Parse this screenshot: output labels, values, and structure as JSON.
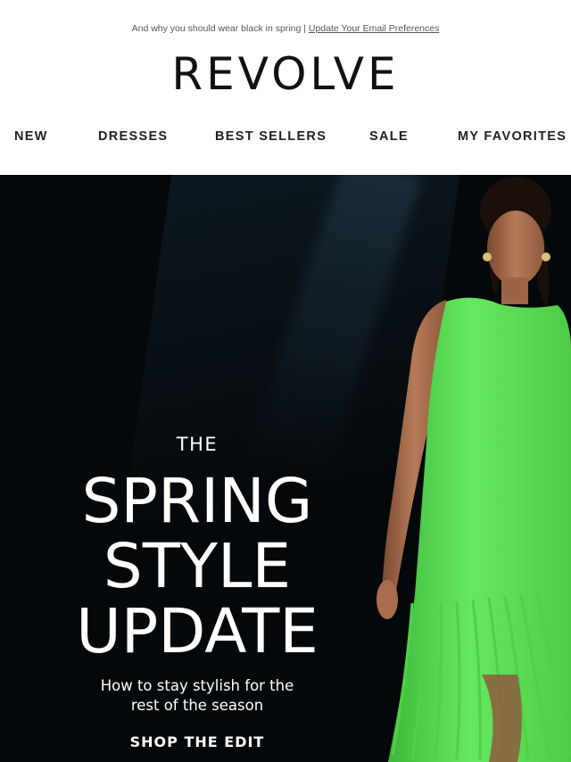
{
  "preheader": {
    "text": "And why you should wear black in spring | ",
    "link_label": "Update Your Email Preferences"
  },
  "logo": {
    "text": "REVOLVE"
  },
  "nav": {
    "items": [
      {
        "label": "NEW"
      },
      {
        "label": "DRESSES"
      },
      {
        "label": "BEST SELLERS"
      },
      {
        "label": "SALE"
      },
      {
        "label": "MY FAVORITES"
      }
    ]
  },
  "hero": {
    "eyebrow": "THE",
    "headline_lines": [
      "SPRING",
      "STYLE",
      "UPDATE"
    ],
    "subtitle_lines": [
      "How to stay stylish for the",
      "rest of the season"
    ],
    "cta_label": "SHOP THE EDIT",
    "colors": {
      "background": "#05080a",
      "dress": "#5fe05a",
      "text": "#ffffff"
    }
  }
}
